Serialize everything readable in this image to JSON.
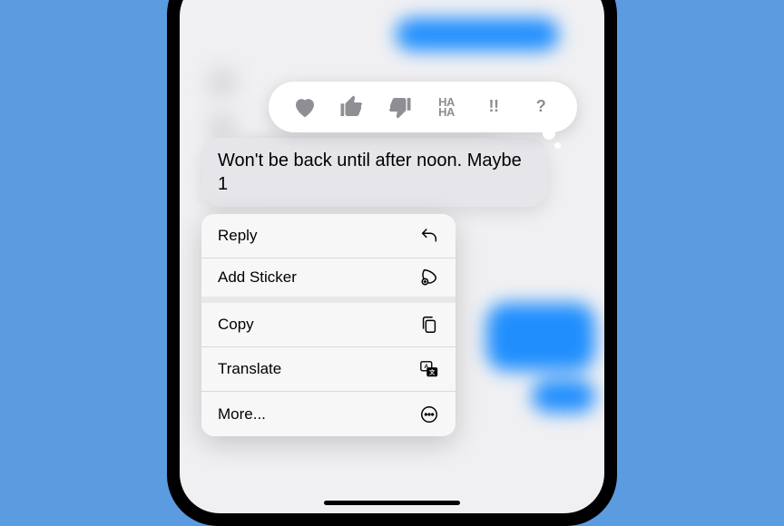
{
  "message": {
    "text": "Won't be back until after noon. Maybe 1"
  },
  "tapback": {
    "heart": "heart",
    "thumbs_up": "thumbs-up",
    "thumbs_down": "thumbs-down",
    "haha": "HA\nHA",
    "exclaim": "!!",
    "question": "?"
  },
  "menu": {
    "reply": "Reply",
    "add_sticker": "Add Sticker",
    "copy": "Copy",
    "translate": "Translate",
    "more": "More..."
  }
}
